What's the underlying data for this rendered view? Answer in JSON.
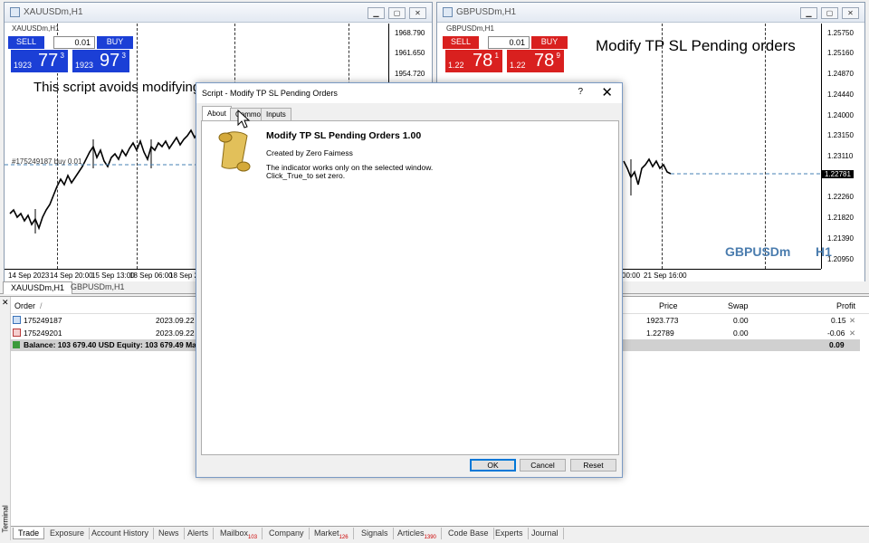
{
  "left_chart": {
    "title": "XAUUSDm,H1",
    "symbol_label": "XAUUSDm,H1",
    "lot": "0.01",
    "sell_label": "SELL",
    "buy_label": "BUY",
    "sell_small": "1923",
    "sell_big": "77",
    "sell_sup": "3",
    "buy_small": "1923",
    "buy_big": "97",
    "buy_sup": "3",
    "prices": [
      "1968.790",
      "1961.650",
      "1954.720"
    ],
    "order_line": "#175249187 buy 0.01",
    "overlay_text": "This script avoids modifying",
    "times": [
      "14 Sep 2023",
      "14 Sep 20:00",
      "15 Sep 13:00",
      "18 Sep 06:00",
      "18 Sep 23"
    ],
    "colors": {
      "sell": "#1b3fd6",
      "buy": "#1b3fd6"
    }
  },
  "right_chart": {
    "title": "GBPUSDm,H1",
    "symbol_label": "GBPUSDm,H1",
    "lot": "0.01",
    "sell_label": "SELL",
    "buy_label": "BUY",
    "sell_small": "1.22",
    "sell_big": "78",
    "sell_sup": "1",
    "buy_small": "1.22",
    "buy_big": "78",
    "buy_sup": "9",
    "overlay_text": "Modify TP SL Pending orders",
    "watermark_symbol": "GBPUSDm",
    "watermark_tf": "H1",
    "prices": [
      "1.25750",
      "1.25160",
      "1.24870",
      "1.24440",
      "1.24000",
      "1.23150",
      "1.23110",
      "1.22781",
      "1.22260",
      "1.21820",
      "1.21390",
      "1.20950"
    ],
    "current_price": "1.22781",
    "times": [
      "00:00",
      "21 Sep 16:00"
    ],
    "colors": {
      "sell": "#d9201f",
      "buy": "#d9201f",
      "watermark": "#4a7cae"
    }
  },
  "chart_tabs": [
    "XAUUSDm,H1",
    "GBPUSDm,H1"
  ],
  "terminal": {
    "side_label": "Terminal",
    "columns": {
      "order": "Order",
      "sort": "/",
      "price": "Price",
      "swap": "Swap",
      "profit": "Profit"
    },
    "rows": [
      {
        "order": "175249187",
        "time": "2023.09.22 0",
        "price": "1923.773",
        "swap": "0.00",
        "profit": "0.15"
      },
      {
        "order": "175249201",
        "time": "2023.09.22 0",
        "price": "1.22789",
        "swap": "0.00",
        "profit": "-0.06"
      }
    ],
    "balance_text": "Balance: 103 679.40 USD  Equity: 103 679.49  Mar",
    "balance_profit": "0.09",
    "tabs": [
      {
        "label": "Trade",
        "badge": ""
      },
      {
        "label": "Exposure",
        "badge": ""
      },
      {
        "label": "Account History",
        "badge": ""
      },
      {
        "label": "News",
        "badge": ""
      },
      {
        "label": "Alerts",
        "badge": ""
      },
      {
        "label": "Mailbox",
        "badge": "103"
      },
      {
        "label": "Company",
        "badge": ""
      },
      {
        "label": "Market",
        "badge": "126"
      },
      {
        "label": "Signals",
        "badge": ""
      },
      {
        "label": "Articles",
        "badge": "1390"
      },
      {
        "label": "Code Base",
        "badge": ""
      },
      {
        "label": "Experts",
        "badge": ""
      },
      {
        "label": "Journal",
        "badge": ""
      }
    ]
  },
  "dialog": {
    "title": "Script - Modify TP SL Pending Orders",
    "help": "?",
    "close": "✕",
    "tabs": [
      "About",
      "Common",
      "Inputs"
    ],
    "name": "Modify TP SL Pending Orders 1.00",
    "author": "Created by Zero Faimess",
    "desc1": "The indicator works only on the selected window.",
    "desc2": "Click_True_to set zero.",
    "ok": "OK",
    "cancel": "Cancel",
    "reset": "Reset"
  }
}
